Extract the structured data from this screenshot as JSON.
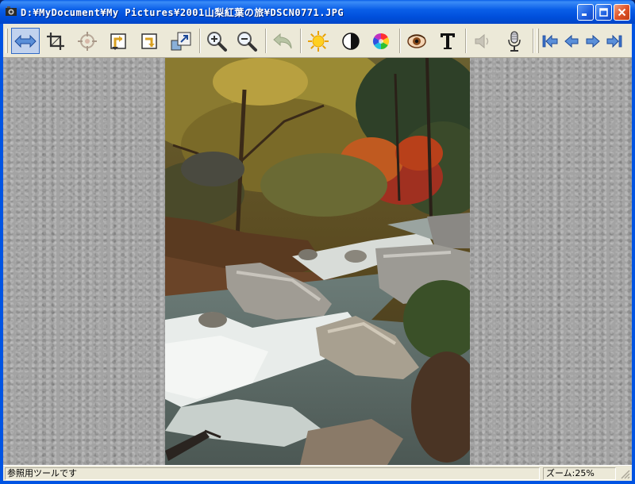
{
  "window": {
    "title": "D:¥MyDocument¥My Pictures¥2001山梨紅葉の旅¥DSCN0771.JPG",
    "icon": "app-icon"
  },
  "caption_buttons": [
    {
      "name": "minimize-button",
      "icon": "minimize-icon"
    },
    {
      "name": "maximize-button",
      "icon": "maximize-icon"
    },
    {
      "name": "close-button",
      "icon": "close-icon"
    }
  ],
  "toolbar": {
    "buttons": [
      {
        "name": "fit-width-button",
        "icon": "double-arrow-icon",
        "active": true
      },
      {
        "name": "crop-button",
        "icon": "crop-icon"
      },
      {
        "name": "target-button",
        "icon": "crosshair-icon"
      },
      {
        "name": "rotate-left-button",
        "icon": "rotate-left-icon"
      },
      {
        "name": "rotate-right-button",
        "icon": "rotate-right-icon"
      },
      {
        "name": "resize-button",
        "icon": "resize-icon"
      },
      {
        "name": "zoom-in-button",
        "icon": "zoom-in-icon"
      },
      {
        "name": "zoom-out-button",
        "icon": "zoom-out-icon"
      },
      {
        "name": "undo-button",
        "icon": "undo-icon"
      },
      {
        "name": "brightness-button",
        "icon": "sun-icon"
      },
      {
        "name": "contrast-button",
        "icon": "contrast-icon"
      },
      {
        "name": "color-button",
        "icon": "color-wheel-icon"
      },
      {
        "name": "red-eye-button",
        "icon": "eye-icon"
      },
      {
        "name": "text-button",
        "icon": "text-icon"
      },
      {
        "name": "sound-button",
        "icon": "speaker-icon"
      },
      {
        "name": "record-button",
        "icon": "microphone-icon"
      },
      {
        "name": "first-image-button",
        "icon": "first-icon"
      },
      {
        "name": "prev-image-button",
        "icon": "prev-icon"
      },
      {
        "name": "next-image-button",
        "icon": "next-icon"
      },
      {
        "name": "last-image-button",
        "icon": "last-icon"
      }
    ]
  },
  "status": {
    "message": "参照用ツールです",
    "zoom": "ズーム:25%"
  },
  "colors": {
    "titlebar": "#0a5fe8",
    "toolbar_bg": "#ece9d8",
    "viewer_bg": "#a3a3a3",
    "accent": "#316ac5"
  }
}
